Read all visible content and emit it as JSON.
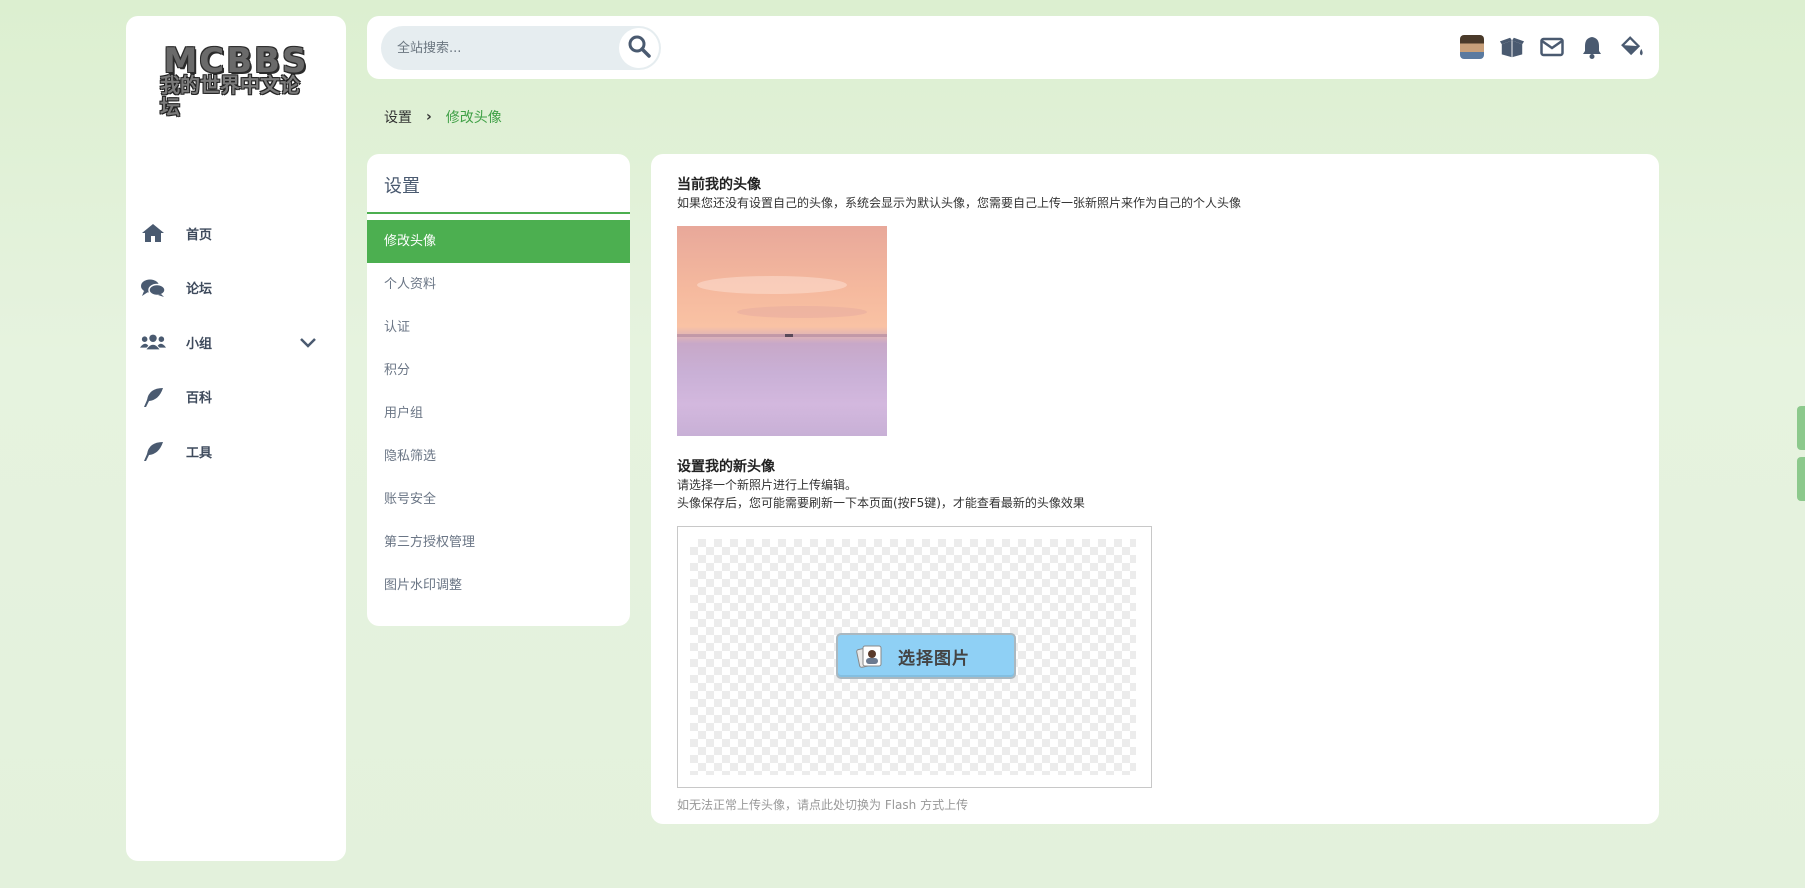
{
  "logo": {
    "top_text": "MCBBS",
    "bottom_text": "我的世界中文论坛"
  },
  "sidebar": {
    "items": [
      {
        "label": "首页",
        "icon": "home-icon"
      },
      {
        "label": "论坛",
        "icon": "comments-icon"
      },
      {
        "label": "小组",
        "icon": "users-icon",
        "expandable": true
      },
      {
        "label": "百科",
        "icon": "feather-icon"
      },
      {
        "label": "工具",
        "icon": "feather-icon"
      }
    ]
  },
  "header": {
    "search_placeholder": "全站搜索...",
    "icons": [
      "avatar",
      "box-open-icon",
      "envelope-icon",
      "bell-icon",
      "paint-bucket-icon"
    ]
  },
  "breadcrumb": {
    "root": "设置",
    "current": "修改头像"
  },
  "settings_menu": {
    "title": "设置",
    "items": [
      "修改头像",
      "个人资料",
      "认证",
      "积分",
      "用户组",
      "隐私筛选",
      "账号安全",
      "第三方授权管理",
      "图片水印调整"
    ],
    "active_index": 0
  },
  "main": {
    "current_title": "当前我的头像",
    "current_desc": "如果您还没有设置自己的头像，系统会显示为默认头像，您需要自己上传一张新照片来作为自己的个人头像",
    "new_title": "设置我的新头像",
    "new_desc1": "请选择一个新照片进行上传编辑。",
    "new_desc2": "头像保存后，您可能需要刷新一下本页面(按F5键)，才能查看最新的头像效果",
    "choose_button": "选择图片",
    "flash_link": "如无法正常上传头像，请点此处切换为 Flash 方式上传"
  },
  "colors": {
    "accent": "#4caf50",
    "nav_text": "#3e4a5c",
    "button_bg": "#8fd0f5"
  }
}
